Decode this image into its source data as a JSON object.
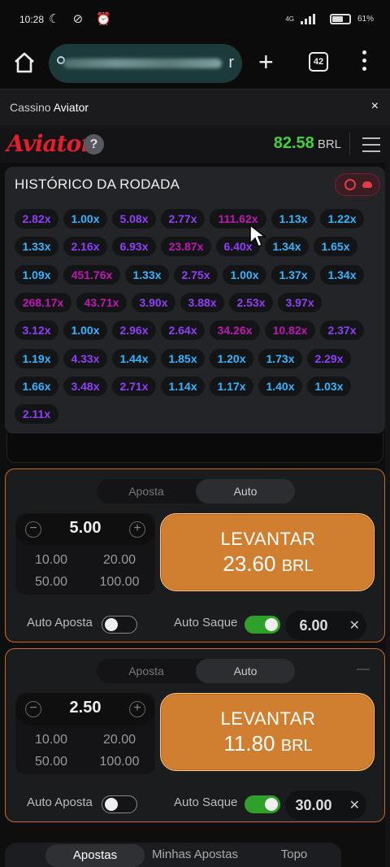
{
  "status": {
    "time": "10:28",
    "network": "4G",
    "battery": "61%"
  },
  "browser": {
    "url_tail": "r",
    "tab_count": "42"
  },
  "app": {
    "title_prefix": "Cassino",
    "title_name": "Aviator",
    "close": "×"
  },
  "game": {
    "logo": "Aviator",
    "balance": "82.58",
    "currency": "BRL"
  },
  "history": {
    "title": "HISTÓRICO DA RODADA",
    "rows": [
      [
        {
          "v": "2.82x",
          "c": "purple"
        },
        {
          "v": "1.00x",
          "c": "blue"
        },
        {
          "v": "5.08x",
          "c": "purple"
        },
        {
          "v": "2.77x",
          "c": "purple"
        },
        {
          "v": "111.62x",
          "c": "pink"
        },
        {
          "v": "1.13x",
          "c": "blue"
        },
        {
          "v": "1.22x",
          "c": "blue"
        }
      ],
      [
        {
          "v": "1.33x",
          "c": "blue"
        },
        {
          "v": "2.16x",
          "c": "purple"
        },
        {
          "v": "6.93x",
          "c": "purple"
        },
        {
          "v": "23.87x",
          "c": "pink"
        },
        {
          "v": "6.40x",
          "c": "purple"
        },
        {
          "v": "1.34x",
          "c": "blue"
        },
        {
          "v": "1.65x",
          "c": "blue"
        }
      ],
      [
        {
          "v": "1.09x",
          "c": "blue"
        },
        {
          "v": "451.76x",
          "c": "pink"
        },
        {
          "v": "1.33x",
          "c": "blue"
        },
        {
          "v": "2.75x",
          "c": "purple"
        },
        {
          "v": "1.00x",
          "c": "blue"
        },
        {
          "v": "1.37x",
          "c": "blue"
        },
        {
          "v": "1.34x",
          "c": "blue"
        }
      ],
      [
        {
          "v": "268.17x",
          "c": "pink"
        },
        {
          "v": "43.71x",
          "c": "pink"
        },
        {
          "v": "3.90x",
          "c": "purple"
        },
        {
          "v": "3.88x",
          "c": "purple"
        },
        {
          "v": "2.53x",
          "c": "purple"
        },
        {
          "v": "3.97x",
          "c": "purple"
        }
      ],
      [
        {
          "v": "3.12x",
          "c": "purple"
        },
        {
          "v": "1.00x",
          "c": "blue"
        },
        {
          "v": "2.96x",
          "c": "purple"
        },
        {
          "v": "2.64x",
          "c": "purple"
        },
        {
          "v": "34.26x",
          "c": "pink"
        },
        {
          "v": "10.82x",
          "c": "pink"
        },
        {
          "v": "2.37x",
          "c": "purple"
        }
      ],
      [
        {
          "v": "1.19x",
          "c": "blue"
        },
        {
          "v": "4.33x",
          "c": "purple"
        },
        {
          "v": "1.44x",
          "c": "blue"
        },
        {
          "v": "1.85x",
          "c": "blue"
        },
        {
          "v": "1.20x",
          "c": "blue"
        },
        {
          "v": "1.73x",
          "c": "blue"
        },
        {
          "v": "2.29x",
          "c": "purple"
        }
      ],
      [
        {
          "v": "1.66x",
          "c": "blue"
        },
        {
          "v": "3.48x",
          "c": "purple"
        },
        {
          "v": "2.71x",
          "c": "purple"
        },
        {
          "v": "1.14x",
          "c": "blue"
        },
        {
          "v": "1.17x",
          "c": "blue"
        },
        {
          "v": "1.40x",
          "c": "blue"
        },
        {
          "v": "1.03x",
          "c": "blue"
        }
      ],
      [
        {
          "v": "2.11x",
          "c": "purple"
        }
      ]
    ]
  },
  "panels": [
    {
      "tab_bet": "Aposta",
      "tab_auto": "Auto",
      "active_tab": "Auto",
      "amount": "5.00",
      "quick": [
        "10.00",
        "20.00",
        "50.00",
        "100.00"
      ],
      "cashout_label": "LEVANTAR",
      "cashout_amount": "23.60",
      "cashout_currency": "BRL",
      "auto_bet_label": "Auto Aposta",
      "auto_bet_on": false,
      "auto_cashout_label": "Auto Saque",
      "auto_cashout_on": true,
      "auto_cashout_value": "6.00"
    },
    {
      "tab_bet": "Aposta",
      "tab_auto": "Auto",
      "active_tab": "Auto",
      "amount": "2.50",
      "quick": [
        "10.00",
        "20.00",
        "50.00",
        "100.00"
      ],
      "cashout_label": "LEVANTAR",
      "cashout_amount": "11.80",
      "cashout_currency": "BRL",
      "auto_bet_label": "Auto Aposta",
      "auto_bet_on": false,
      "auto_cashout_label": "Auto Saque",
      "auto_cashout_on": true,
      "auto_cashout_value": "30.00"
    }
  ],
  "bottom_tabs": [
    "Apostas",
    "Minhas Apostas",
    "Topo"
  ],
  "colors": {
    "blue": "#34b4ff",
    "purple": "#913ef8",
    "pink": "#c017b4",
    "accent": "#d07f30",
    "balance": "#43d23a"
  }
}
